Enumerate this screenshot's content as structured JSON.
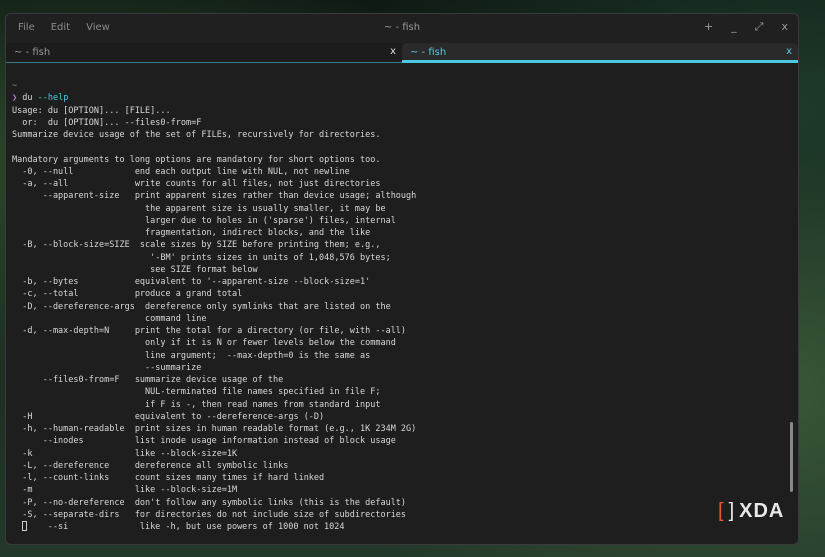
{
  "window": {
    "title": "~ - fish",
    "menu": [
      "File",
      "Edit",
      "View"
    ],
    "controls": {
      "new_tab": "+",
      "minimize": "_",
      "maximize": "⤢",
      "close": "x"
    }
  },
  "tabs": [
    {
      "label": "~ - fish",
      "active": false,
      "close": "x"
    },
    {
      "label": "~ - fish",
      "active": true,
      "close": "x"
    }
  ],
  "terminal": {
    "cwd": "~",
    "prompt_symbol": "❯",
    "command": "du",
    "command_arg": "--help",
    "output": [
      "Usage: du [OPTION]... [FILE]...",
      "  or:  du [OPTION]... --files0-from=F",
      "Summarize device usage of the set of FILEs, recursively for directories.",
      "",
      "Mandatory arguments to long options are mandatory for short options too.",
      "  -0, --null            end each output line with NUL, not newline",
      "  -a, --all             write counts for all files, not just directories",
      "      --apparent-size   print apparent sizes rather than device usage; although",
      "                          the apparent size is usually smaller, it may be",
      "                          larger due to holes in ('sparse') files, internal",
      "                          fragmentation, indirect blocks, and the like",
      "  -B, --block-size=SIZE  scale sizes by SIZE before printing them; e.g.,",
      "                           '-BM' prints sizes in units of 1,048,576 bytes;",
      "                           see SIZE format below",
      "  -b, --bytes           equivalent to '--apparent-size --block-size=1'",
      "  -c, --total           produce a grand total",
      "  -D, --dereference-args  dereference only symlinks that are listed on the",
      "                          command line",
      "  -d, --max-depth=N     print the total for a directory (or file, with --all)",
      "                          only if it is N or fewer levels below the command",
      "                          line argument;  --max-depth=0 is the same as",
      "                          --summarize",
      "      --files0-from=F   summarize device usage of the",
      "                          NUL-terminated file names specified in file F;",
      "                          if F is -, then read names from standard input",
      "  -H                    equivalent to --dereference-args (-D)",
      "  -h, --human-readable  print sizes in human readable format (e.g., 1K 234M 2G)",
      "      --inodes          list inode usage information instead of block usage",
      "  -k                    like --block-size=1K",
      "  -L, --dereference     dereference all symbolic links",
      "  -l, --count-links     count sizes many times if hard linked",
      "  -m                    like --block-size=1M",
      "  -P, --no-dereference  don't follow any symbolic links (this is the default)",
      "  -S, --separate-dirs   for directories do not include size of subdirectories"
    ],
    "last_line": "    --si              like -h, but use powers of 1000 not 1024"
  },
  "watermark": {
    "text": "XDA"
  }
}
